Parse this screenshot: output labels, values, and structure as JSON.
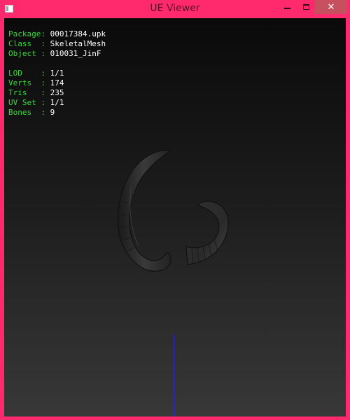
{
  "window": {
    "title": "UE Viewer",
    "close_glyph": "✕",
    "colors": {
      "frame": "#ff2a6e",
      "close": "#c7505f"
    }
  },
  "info": {
    "package_label": "Package: ",
    "package_value": "00017384.upk",
    "class_label": "Class  : ",
    "class_value": "SkeletalMesh",
    "object_label": "Object : ",
    "object_value": "010031_JinF",
    "lod_label": "LOD    : ",
    "lod_value": "1/1",
    "verts_label": "Verts  : ",
    "verts_value": "174",
    "tris_label": "Tris   : ",
    "tris_value": "235",
    "uvset_label": "UV Set : ",
    "uvset_value": "1/1",
    "bones_label": "Bones  : ",
    "bones_value": "9",
    "colors": {
      "label": "#33dd33",
      "value": "#ffffff"
    }
  }
}
